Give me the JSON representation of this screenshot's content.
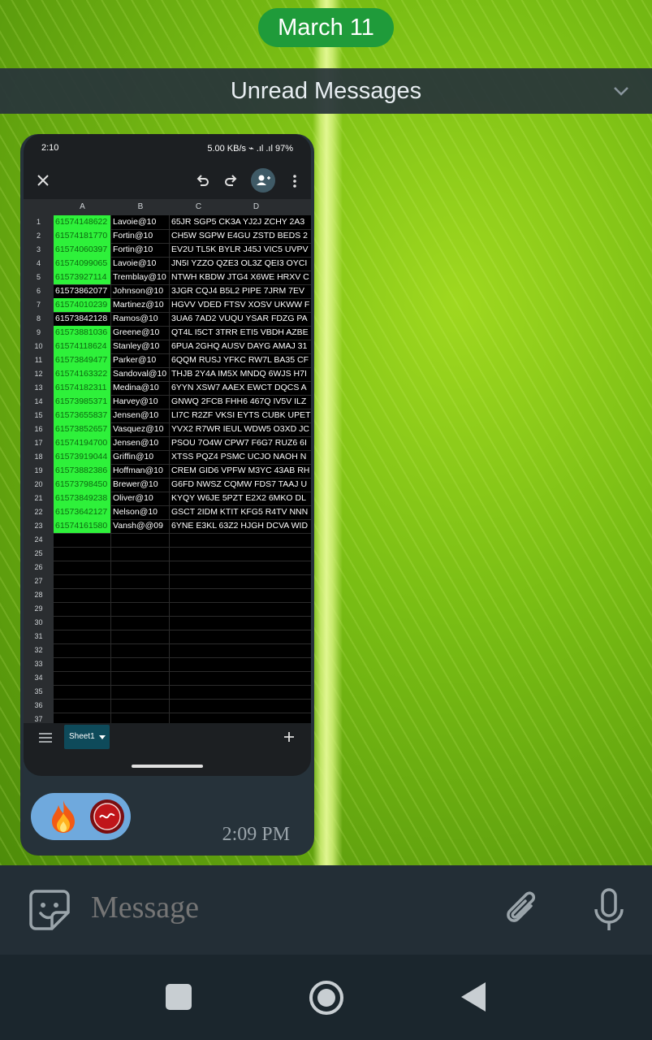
{
  "date_pill": "March 11",
  "unread_bar": {
    "label": "Unread Messages"
  },
  "phone": {
    "status_time": "2:10",
    "status_right": "5.00 KB/s ⌁ .ıl .ıl 97%",
    "columns": [
      "A",
      "B",
      "C",
      "D"
    ],
    "rows": [
      {
        "n": "1",
        "a": "61574148622",
        "b": "Lavoie@10",
        "c": "65JR SGP5 CK3A YJ2J ZCHY 2A3",
        "green": true
      },
      {
        "n": "2",
        "a": "61574181770",
        "b": "Fortin@10",
        "c": "CH5W SGPW E4GU ZSTD BEDS 2",
        "green": true
      },
      {
        "n": "3",
        "a": "61574060397",
        "b": "Fortin@10",
        "c": "EV2U TL5K BYLR J45J VIC5 UVPV",
        "green": true
      },
      {
        "n": "4",
        "a": "61574099065",
        "b": "Lavoie@10",
        "c": "JN5I YZZO QZE3 OL3Z QEI3 OYCI",
        "green": true
      },
      {
        "n": "5",
        "a": "61573927114",
        "b": "Tremblay@10",
        "c": "NTWH KBDW JTG4 X6WE HRXV C",
        "green": true
      },
      {
        "n": "6",
        "a": "61573862077",
        "b": "Johnson@10",
        "c": "3JGR CQJ4 B5L2 PIPE 7JRM 7EV",
        "green": false
      },
      {
        "n": "7",
        "a": "61574010239",
        "b": "Martinez@10",
        "c": "HGVV VDED FTSV XOSV UKWW F",
        "green": true
      },
      {
        "n": "8",
        "a": "61573842128",
        "b": "Ramos@10",
        "c": "3UA6 7AD2 VUQU YSAR FDZG PA",
        "green": false
      },
      {
        "n": "9",
        "a": "61573881036",
        "b": "Greene@10",
        "c": "QT4L I5CT 3TRR ETI5 VBDH AZBE",
        "green": true
      },
      {
        "n": "10",
        "a": "61574118624",
        "b": "Stanley@10",
        "c": "6PUA 2GHQ AUSV DAYG AMAJ 31",
        "green": true
      },
      {
        "n": "11",
        "a": "61573849477",
        "b": "Parker@10",
        "c": "6QQM RUSJ YFKC RW7L BA35 CF",
        "green": true
      },
      {
        "n": "12",
        "a": "61574163322",
        "b": "Sandoval@10",
        "c": "THJB 2Y4A IM5X MNDQ 6WJS H7I",
        "green": true
      },
      {
        "n": "13",
        "a": "61574182311",
        "b": "Medina@10",
        "c": "6YYN XSW7 AAEX EWCT DQCS A",
        "green": true
      },
      {
        "n": "14",
        "a": "61573985371",
        "b": "Harvey@10",
        "c": "GNWQ 2FCB FHH6 467Q IV5V ILZ",
        "green": true
      },
      {
        "n": "15",
        "a": "61573655837",
        "b": "Jensen@10",
        "c": "LI7C R2ZF VKSI EYTS CUBK UPET",
        "green": true
      },
      {
        "n": "16",
        "a": "61573852657",
        "b": "Vasquez@10",
        "c": "YVX2 R7WR IEUL WDW5 O3XD JC",
        "green": true
      },
      {
        "n": "17",
        "a": "61574194700",
        "b": "Jensen@10",
        "c": "PSOU 7O4W CPW7 F6G7 RUZ6 6I",
        "green": true
      },
      {
        "n": "18",
        "a": "61573919044",
        "b": "Griffin@10",
        "c": "XTSS PQZ4 PSMC UCJO NAOH N",
        "green": true
      },
      {
        "n": "19",
        "a": "61573882386",
        "b": "Hoffman@10",
        "c": "CREM GID6 VPFW M3YC 43AB RH",
        "green": true
      },
      {
        "n": "20",
        "a": "61573798450",
        "b": "Brewer@10",
        "c": "G6FD NWSZ CQMW FDS7 TAAJ U",
        "green": true
      },
      {
        "n": "21",
        "a": "61573849238",
        "b": "Oliver@10",
        "c": "KYQY W6JE 5PZT E2X2 6MKO DL",
        "green": true
      },
      {
        "n": "22",
        "a": "61573642127",
        "b": "Nelson@10",
        "c": "GSCT 2IDM KTIT KFG5 R4TV NNN",
        "green": true
      },
      {
        "n": "23",
        "a": "61574161580",
        "b": "Vansh@@09",
        "c": "6YNE E3KL 63Z2 HJGH DCVA WID",
        "green": true
      }
    ],
    "empty_rows": [
      "24",
      "25",
      "26",
      "27",
      "28",
      "29",
      "30",
      "31",
      "32",
      "33",
      "34",
      "35",
      "36",
      "37"
    ],
    "sheet_tab": "Sheet1"
  },
  "message": {
    "time": "2:09 PM",
    "reactions": [
      "fire",
      "sticker"
    ]
  },
  "input": {
    "placeholder": "Message"
  },
  "colors": {
    "date_pill": "#1f9b3a",
    "green_cell": "#2ef13a",
    "bubble": "#26323a"
  }
}
